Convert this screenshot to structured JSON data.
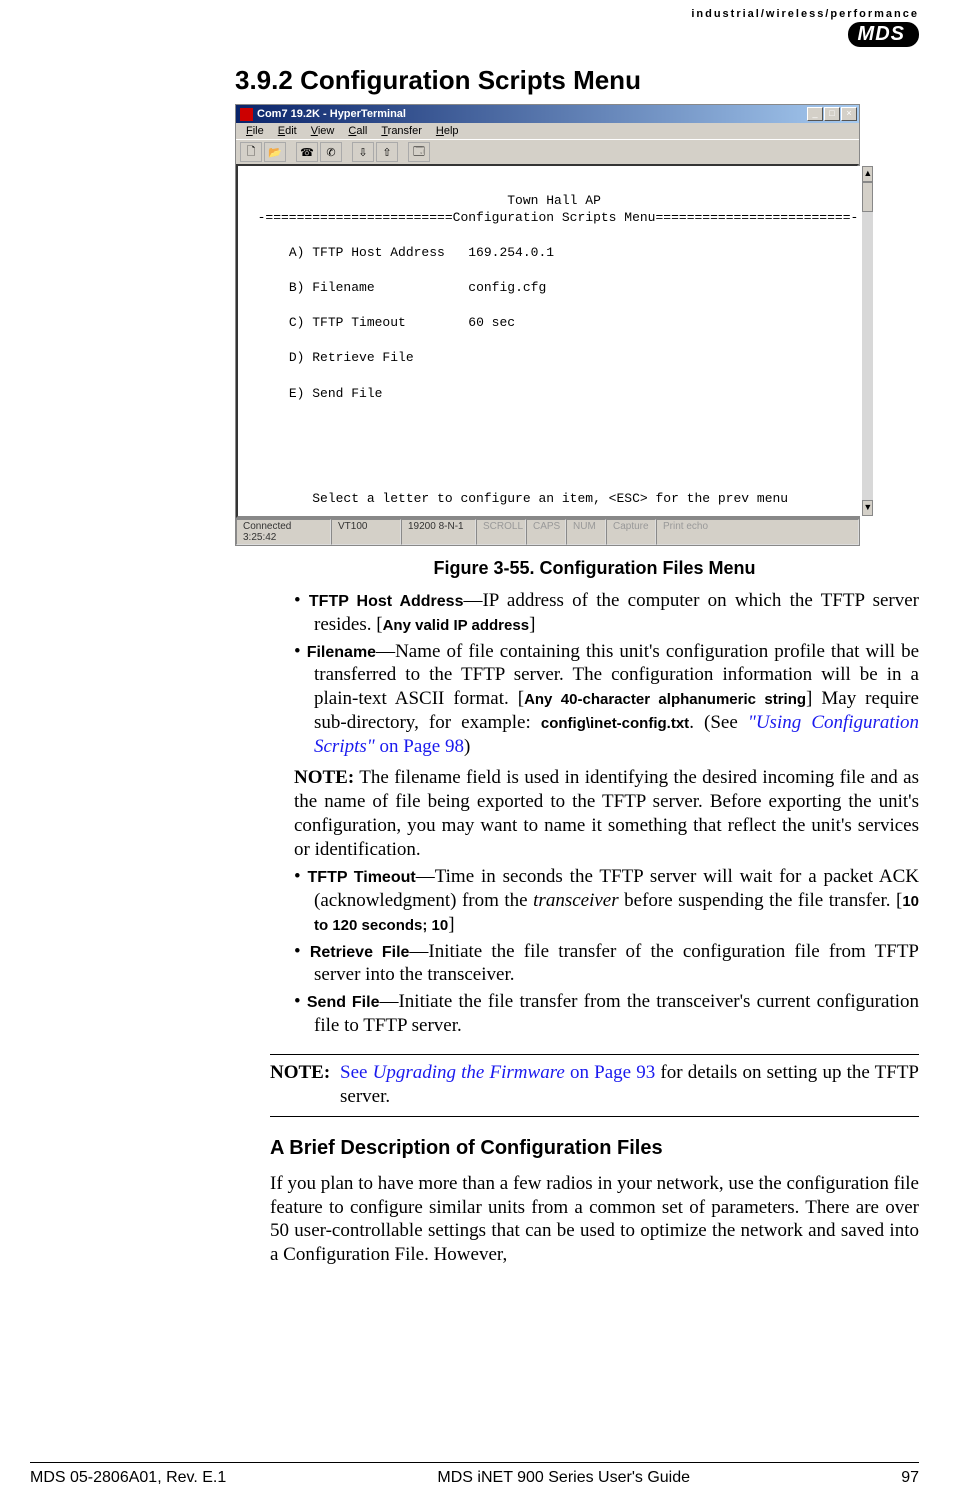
{
  "header": {
    "tagline": "industrial/wireless/performance",
    "logo": "MDS"
  },
  "section": {
    "number": "3.9.2",
    "title": "Configuration Scripts Menu"
  },
  "terminal": {
    "window_title": "Com7 19.2K - HyperTerminal",
    "menus": {
      "file": "File",
      "edit": "Edit",
      "view": "View",
      "call": "Call",
      "transfer": "Transfer",
      "help": "Help"
    },
    "body_title": "Town Hall AP",
    "body_subtitle": "Configuration Scripts Menu",
    "items": {
      "a_label": "A) TFTP Host Address",
      "a_value": "169.254.0.1",
      "b_label": "B) Filename",
      "b_value": "config.cfg",
      "c_label": "C) TFTP Timeout",
      "c_value": "60 sec",
      "d_label": "D) Retrieve File",
      "e_label": "E) Send File"
    },
    "body_footer": "Select a letter to configure an item, <ESC> for the prev menu",
    "status": {
      "connected": "Connected 3:25:42",
      "term": "VT100",
      "baud": "19200 8-N-1",
      "scroll": "SCROLL",
      "caps": "CAPS",
      "num": "NUM",
      "capture": "Capture",
      "echo": "Print echo"
    }
  },
  "figure_caption": "Figure 3-55. Configuration Files Menu",
  "bullets": {
    "tftp_host_label": "TFTP Host Address",
    "tftp_host_text": "—IP address of the computer on which the TFTP server resides. [",
    "tftp_host_constraint": "Any valid IP address",
    "filename_label": "Filename",
    "filename_text1": "—Name of file containing this unit's configuration profile that will be transferred to the TFTP server. The configuration information will be in a plain-text ASCII format. [",
    "filename_constraint": "Any 40-character alphanumeric string",
    "filename_text2": "] May require sub-directory, for example: ",
    "filename_example": "config\\inet-config.txt",
    "filename_see": ". (See ",
    "filename_link": "\"Using Configuration Scripts\"",
    "filename_link_page": " on Page 98",
    "filename_close": ")",
    "note_label": "NOTE:",
    "note_text": " The filename field is used in identifying the desired incoming file and as the name of file being exported to the TFTP server. Before exporting the unit's configuration, you may want to name it something that reflect the unit's services or identification.",
    "timeout_label": "TFTP Timeout",
    "timeout_text": "—Time in seconds the TFTP server will wait for a packet ACK (acknowledgment) from the ",
    "timeout_italic": "transceiver",
    "timeout_text2": " before suspending the file transfer. [",
    "timeout_constraint": "10 to 120 seconds; 10",
    "retrieve_label": "Retrieve File",
    "retrieve_text": "—Initiate the file transfer of the configuration file from TFTP server into the transceiver.",
    "send_label": "Send File",
    "send_text": "—Initiate the file transfer from the transceiver's current configuration file to TFTP server."
  },
  "note_section": {
    "label": "NOTE:",
    "see": "See ",
    "link": "Upgrading the Firmware ",
    "link_page": " on Page 93",
    "rest": " for details on setting up the TFTP server."
  },
  "brief": {
    "title": "A Brief Description of Configuration Files",
    "para": "If you plan to have more than a few radios in your network, use the configuration file feature to configure similar units from a common set of parameters. There are over 50 user-controllable settings that can be used to optimize the network and saved into a Configuration File. However,"
  },
  "footer": {
    "left": "MDS 05-2806A01, Rev. E.1",
    "center": "MDS iNET 900 Series User's Guide",
    "right": "97"
  }
}
